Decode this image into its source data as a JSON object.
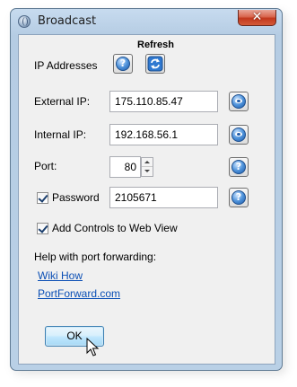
{
  "window": {
    "title": "Broadcast",
    "close_symbol": "✕"
  },
  "header": {
    "refresh_label": "Refresh"
  },
  "ip_addresses": {
    "label": "IP Addresses",
    "help_icon": "question-icon",
    "refresh_icon": "refresh-icon"
  },
  "external_ip": {
    "label": "External IP:",
    "value": "175.110.85.47",
    "action_icon": "eye-icon"
  },
  "internal_ip": {
    "label": "Internal IP:",
    "value": "192.168.56.1",
    "action_icon": "eye-icon"
  },
  "port": {
    "label": "Port:",
    "value": "80"
  },
  "password": {
    "label": "Password",
    "checked": true,
    "value": "2105671"
  },
  "add_controls": {
    "label": "Add Controls to Web View",
    "checked": true
  },
  "help": {
    "heading": "Help with port forwarding:",
    "links": [
      "Wiki How",
      "PortForward.com"
    ]
  },
  "buttons": {
    "ok_label": "OK"
  },
  "colors": {
    "accent_blue": "#1e5aa8",
    "close_red": "#c2381d",
    "link_blue": "#0b4fb5"
  }
}
